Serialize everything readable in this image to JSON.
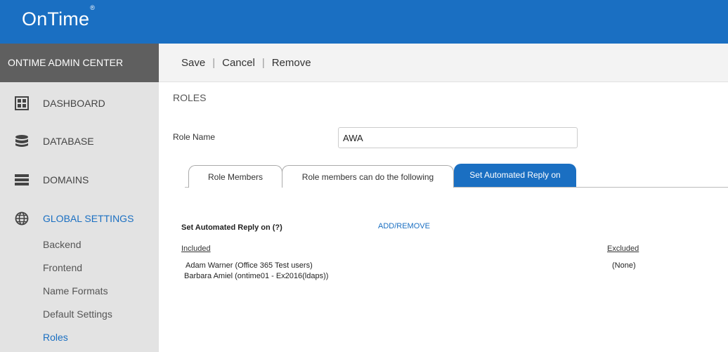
{
  "app": {
    "logo_text": "OnTime",
    "logo_mark": "®",
    "brand_color": "#1a6fc2"
  },
  "sidebar": {
    "header": "ONTIME ADMIN CENTER",
    "items": [
      {
        "label": "DASHBOARD",
        "icon": "dashboard-grid-icon"
      },
      {
        "label": "DATABASE",
        "icon": "database-icon"
      },
      {
        "label": "DOMAINS",
        "icon": "domains-list-icon"
      },
      {
        "label": "GLOBAL SETTINGS",
        "icon": "globe-icon",
        "active": true
      }
    ],
    "subitems": [
      {
        "label": "Backend"
      },
      {
        "label": "Frontend"
      },
      {
        "label": "Name Formats"
      },
      {
        "label": "Default Settings"
      },
      {
        "label": "Roles",
        "active": true
      }
    ]
  },
  "toolbar": {
    "save": "Save",
    "cancel": "Cancel",
    "remove": "Remove",
    "separator": "|"
  },
  "main": {
    "title": "ROLES",
    "role_name_label": "Role Name",
    "role_name_value": "AWA",
    "tabs": [
      {
        "label": "Role Members"
      },
      {
        "label": "Role members can do the following"
      },
      {
        "label": "Set Automated Reply on",
        "active": true
      }
    ],
    "section": {
      "title": "Set Automated Reply on (?)",
      "add_remove": "ADD/REMOVE",
      "included_header": "Included",
      "excluded_header": "Excluded",
      "included": [
        "Adam Warner (Office 365 Test users)",
        "Barbara Amiel (ontime01 - Ex2016(ldaps))"
      ],
      "excluded": [
        "(None)"
      ]
    }
  }
}
